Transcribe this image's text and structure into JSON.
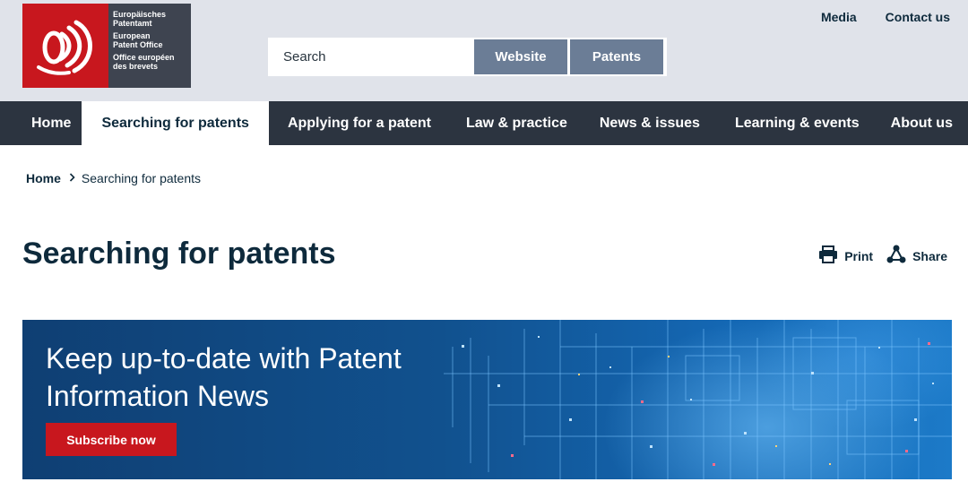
{
  "header": {
    "logo": {
      "lines": [
        "Europäisches",
        "Patentamt",
        "European",
        "Patent Office",
        "Office européen",
        "des brevets"
      ],
      "brand_red": "#c8171e",
      "brand_gray": "#3e4450"
    },
    "top_links": {
      "media": "Media",
      "contact": "Contact us"
    },
    "search": {
      "placeholder": "Search",
      "scope_website": "Website",
      "scope_patents": "Patents"
    }
  },
  "nav": {
    "items": [
      {
        "label": "Home"
      },
      {
        "label": "Searching for patents",
        "active": true
      },
      {
        "label": "Applying for a patent"
      },
      {
        "label": "Law & practice"
      },
      {
        "label": "News & issues"
      },
      {
        "label": "Learning & events"
      },
      {
        "label": "About us"
      }
    ]
  },
  "breadcrumb": {
    "home": "Home",
    "current": "Searching for patents"
  },
  "page": {
    "title": "Searching for patents",
    "print_label": "Print",
    "share_label": "Share"
  },
  "banner": {
    "title": "Keep up-to-date with Patent Information News",
    "button_label": "Subscribe now"
  },
  "colors": {
    "nav_bg": "#2c3440",
    "header_bg": "#e0e3ea",
    "scope_button": "#6b7d96",
    "text_dark": "#0e2a3c",
    "cta_red": "#c8171e"
  },
  "icons": {
    "print": "printer-icon",
    "share": "share-icon",
    "breadcrumb_separator": "chevron-right-icon"
  }
}
